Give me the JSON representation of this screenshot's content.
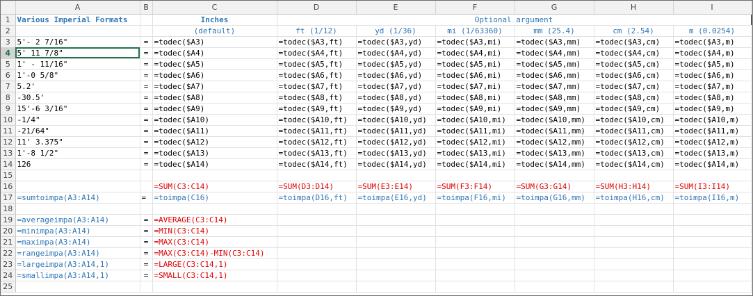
{
  "columns": [
    "A",
    "B",
    "C",
    "D",
    "E",
    "F",
    "G",
    "H",
    "I"
  ],
  "rows": [
    "1",
    "2",
    "3",
    "4",
    "5",
    "6",
    "7",
    "8",
    "9",
    "10",
    "11",
    "12",
    "13",
    "14",
    "15",
    "16",
    "17",
    "18",
    "19",
    "20",
    "21",
    "22",
    "23",
    "24",
    "25"
  ],
  "header": {
    "a1": "Various Imperial Formats",
    "c1": "Inches",
    "c2": "(default)",
    "optional": "Optional argument",
    "units": [
      "ft (1/12)",
      "yd (1/36)",
      "mi (1/63360)",
      "mm (25.4)",
      "cm (2.54)",
      "m (0.0254)"
    ]
  },
  "data_rows": [
    {
      "a": "5'- 2 7/16\"",
      "b": "=",
      "c": "=todec($A3)",
      "d": "=todec($A3,ft)",
      "e": "=todec($A3,yd)",
      "f": "=todec($A3,mi)",
      "g": "=todec($A3,mm)",
      "h": "=todec($A3,cm)",
      "i": "=todec($A3,m)"
    },
    {
      "a": "5' 11 7/8\"",
      "b": "=",
      "c": "=todec($A4)",
      "d": "=todec($A4,ft)",
      "e": "=todec($A4,yd)",
      "f": "=todec($A4,mi)",
      "g": "=todec($A4,mm)",
      "h": "=todec($A4,cm)",
      "i": "=todec($A4,m)"
    },
    {
      "a": "1' - 11/16\"",
      "b": "=",
      "c": "=todec($A5)",
      "d": "=todec($A5,ft)",
      "e": "=todec($A5,yd)",
      "f": "=todec($A5,mi)",
      "g": "=todec($A5,mm)",
      "h": "=todec($A5,cm)",
      "i": "=todec($A5,m)"
    },
    {
      "a": "1'-0 5/8\"",
      "b": "=",
      "c": "=todec($A6)",
      "d": "=todec($A6,ft)",
      "e": "=todec($A6,yd)",
      "f": "=todec($A6,mi)",
      "g": "=todec($A6,mm)",
      "h": "=todec($A6,cm)",
      "i": "=todec($A6,m)"
    },
    {
      "a": "5.2'",
      "b": "=",
      "c": "=todec($A7)",
      "d": "=todec($A7,ft)",
      "e": "=todec($A7,yd)",
      "f": "=todec($A7,mi)",
      "g": "=todec($A7,mm)",
      "h": "=todec($A7,cm)",
      "i": "=todec($A7,m)"
    },
    {
      "a": "-30.5'",
      "b": "=",
      "c": "=todec($A8)",
      "d": "=todec($A8,ft)",
      "e": "=todec($A8,yd)",
      "f": "=todec($A8,mi)",
      "g": "=todec($A8,mm)",
      "h": "=todec($A8,cm)",
      "i": "=todec($A8,m)"
    },
    {
      "a": "15'-6 3/16\"",
      "b": "=",
      "c": "=todec($A9)",
      "d": "=todec($A9,ft)",
      "e": "=todec($A9,yd)",
      "f": "=todec($A9,mi)",
      "g": "=todec($A9,mm)",
      "h": "=todec($A9,cm)",
      "i": "=todec($A9,m)"
    },
    {
      "a": "-1/4\"",
      "b": "=",
      "c": "=todec($A10)",
      "d": "=todec($A10,ft)",
      "e": "=todec($A10,yd)",
      "f": "=todec($A10,mi)",
      "g": "=todec($A10,mm)",
      "h": "=todec($A10,cm)",
      "i": "=todec($A10,m)"
    },
    {
      "a": "-21/64\"",
      "b": "=",
      "c": "=todec($A11)",
      "d": "=todec($A11,ft)",
      "e": "=todec($A11,yd)",
      "f": "=todec($A11,mi)",
      "g": "=todec($A11,mm)",
      "h": "=todec($A11,cm)",
      "i": "=todec($A11,m)"
    },
    {
      "a": "11' 3.375\"",
      "b": "=",
      "c": "=todec($A12)",
      "d": "=todec($A12,ft)",
      "e": "=todec($A12,yd)",
      "f": "=todec($A12,mi)",
      "g": "=todec($A12,mm)",
      "h": "=todec($A12,cm)",
      "i": "=todec($A12,m)"
    },
    {
      "a": "1'-8 1/2\"",
      "b": "=",
      "c": "=todec($A13)",
      "d": "=todec($A13,ft)",
      "e": "=todec($A13,yd)",
      "f": "=todec($A13,mi)",
      "g": "=todec($A13,mm)",
      "h": "=todec($A13,cm)",
      "i": "=todec($A13,m)"
    },
    {
      "a": "126",
      "b": "=",
      "c": "=todec($A14)",
      "d": "=todec($A14,ft)",
      "e": "=todec($A14,yd)",
      "f": "=todec($A14,mi)",
      "g": "=todec($A14,mm)",
      "h": "=todec($A14,cm)",
      "i": "=todec($A14,m)"
    }
  ],
  "row16": {
    "c": "=SUM(C3:C14)",
    "d": "=SUM(D3:D14)",
    "e": "=SUM(E3:E14)",
    "f": "=SUM(F3:F14)",
    "g": "=SUM(G3:G14)",
    "h": "=SUM(H3:H14)",
    "i": "=SUM(I3:I14)"
  },
  "row17": {
    "a": "=sumtoimpa(A3:A14)",
    "b": "=",
    "c": "=toimpa(C16)",
    "d": "=toimpa(D16,ft)",
    "e": "=toimpa(E16,yd)",
    "f": "=toimpa(F16,mi)",
    "g": "=toimpa(G16,mm)",
    "h": "=toimpa(H16,cm)",
    "i": "=toimpa(I16,m)"
  },
  "stats_rows": [
    {
      "a": "=averageimpa(A3:A14)",
      "b": "=",
      "c": "=AVERAGE(C3:C14)"
    },
    {
      "a": "=minimpa(A3:A14)",
      "b": "=",
      "c": "=MIN(C3:C14)"
    },
    {
      "a": "=maximpa(A3:A14)",
      "b": "=",
      "c": "=MAX(C3:C14)"
    },
    {
      "a": "=rangeimpa(A3:A14)",
      "b": "=",
      "c": "=MAX(C3:C14)-MIN(C3:C14)"
    },
    {
      "a": "=largeimpa(A3:A14,1)",
      "b": "=",
      "c": "=LARGE(C3:C14,1)"
    },
    {
      "a": "=smallimpa(A3:A14,1)",
      "b": "=",
      "c": "=SMALL(C3:C14,1)"
    }
  ],
  "colors": {
    "blue": "#2e75b6",
    "red": "#e00000",
    "selection": "#217346"
  }
}
